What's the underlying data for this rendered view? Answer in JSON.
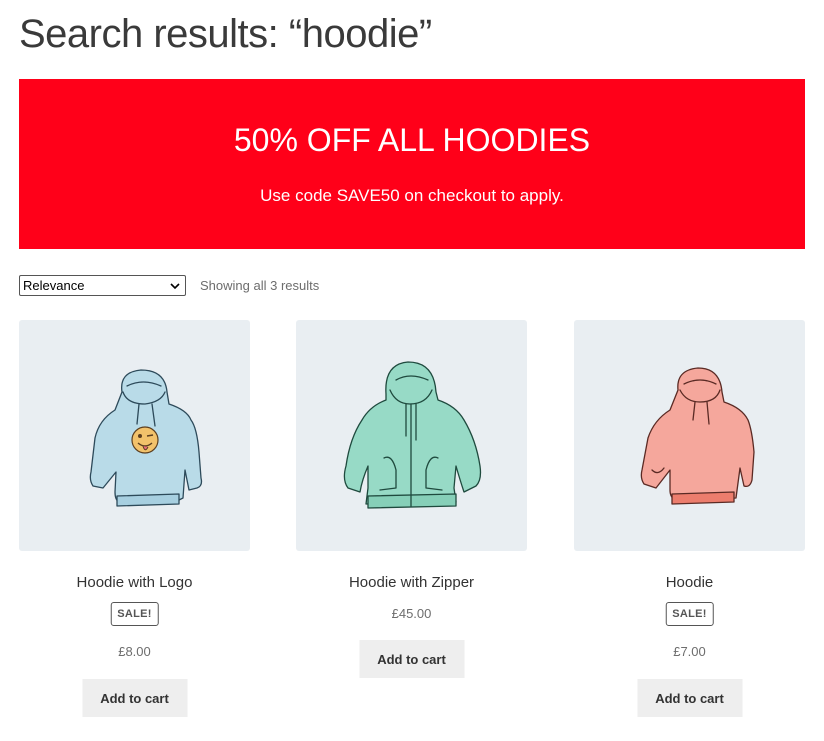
{
  "page": {
    "title": "Search results: “hoodie”"
  },
  "promo": {
    "heading": "50% OFF ALL HOODIES",
    "text": "Use code SAVE50 on checkout to apply.",
    "background_color": "#ff0019"
  },
  "sort": {
    "selected": "Relevance",
    "result_count": "Showing all 3 results"
  },
  "products": [
    {
      "name": "Hoodie with Logo",
      "sale_badge": "SALE!",
      "price": "£8.00",
      "button": "Add to cart",
      "color": "#b9dbe8",
      "icon": "hoodie-with-logo-image"
    },
    {
      "name": "Hoodie with Zipper",
      "sale_badge": "",
      "price": "£45.00",
      "button": "Add to cart",
      "color": "#97dac6",
      "icon": "zip-hoodie-image"
    },
    {
      "name": "Hoodie",
      "sale_badge": "SALE!",
      "price": "£7.00",
      "button": "Add to cart",
      "color": "#f5a79c",
      "icon": "pink-hoodie-image"
    }
  ]
}
